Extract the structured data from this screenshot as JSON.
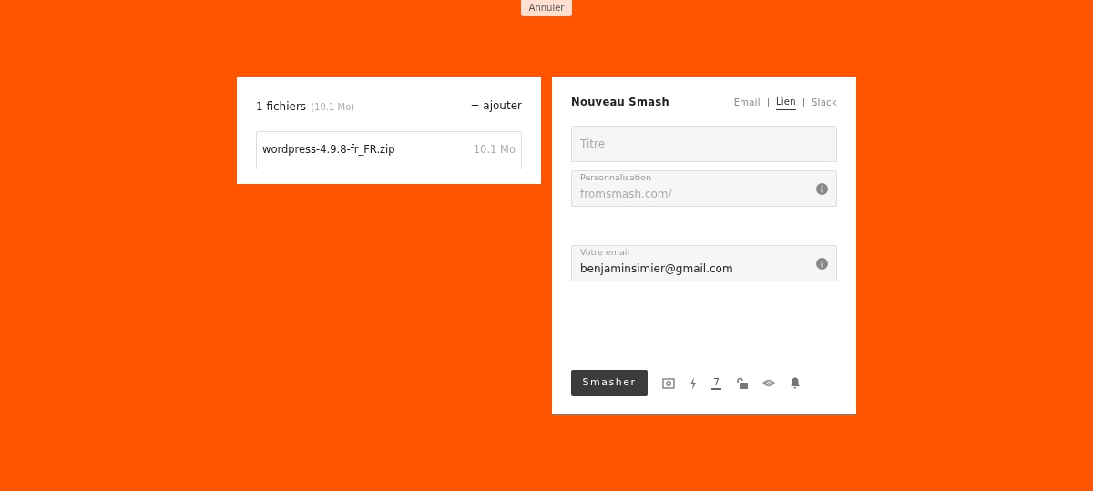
{
  "cancel_button": "Annuler",
  "files_panel": {
    "count": "1 fichiers",
    "total_size": "(10.1 Mo)",
    "add_link": "+ ajouter",
    "files": [
      {
        "name": "wordpress-4.9.8-fr_FR.zip",
        "size": "10.1 Mo"
      }
    ]
  },
  "smash_panel": {
    "title": "Nouveau Smash",
    "tabs": [
      {
        "label": "Email",
        "selected": false
      },
      {
        "label": "Lien",
        "selected": true
      },
      {
        "label": "Slack",
        "selected": false
      }
    ],
    "fields": [
      {
        "kind": "plain",
        "placeholder": "Titre"
      },
      {
        "kind": "labeled",
        "label": "Personnalisation",
        "value": "fromsmash.com/",
        "muted": true,
        "info": true
      },
      {
        "kind": "divider"
      },
      {
        "kind": "labeled",
        "label": "Votre email",
        "value": "benjaminsimier@gmail.com",
        "muted": false,
        "info": true
      }
    ],
    "submit_button": "Smasher",
    "days_value": "7"
  }
}
